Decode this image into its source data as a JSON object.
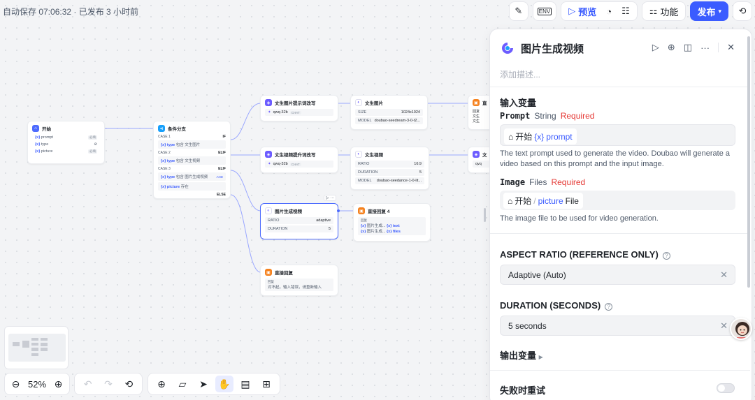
{
  "status": {
    "autosave": "自动保存 07:06:32 · 已发布 3 小时前"
  },
  "topbar": {
    "env_label": "ENV",
    "preview_label": "预览",
    "features_label": "功能",
    "publish_label": "发布"
  },
  "nodes": {
    "start": {
      "title": "开始",
      "rows": [
        {
          "var": "prompt",
          "tag": "必填"
        },
        {
          "var": "type",
          "tag": ""
        },
        {
          "var": "picture",
          "tag": "必填"
        }
      ]
    },
    "cond": {
      "title": "条件分支",
      "case1": "CASE 1",
      "case1_kw": "IF",
      "case1_line": "包含 文生图片",
      "case1_var": "type",
      "case2": "CASE 2",
      "case2_kw": "ELIF",
      "case2_line": "包含 文生视频",
      "case2_var": "type",
      "case3": "CASE 3",
      "case3_kw": "ELIF",
      "case3_line1": "包含 图片生成视频",
      "case3_var1": "type",
      "case3_and": "AND",
      "case3_line2": "存在",
      "case3_var2": "picture",
      "else_kw": "ELSE"
    },
    "t2i_prompt": {
      "title": "文生图片提示词改写",
      "model": "qwq-32b",
      "chip": "CHAT"
    },
    "t2i": {
      "title": "文生图片",
      "size_label": "SIZE",
      "size_val": "1024x1024",
      "model_label": "MODEL",
      "model_val": "doubao-seedream-3-0-t2..."
    },
    "t2v_prompt": {
      "title": "文生视频提升词改写",
      "model": "qwq-32b",
      "chip": "CHAT"
    },
    "t2v": {
      "title": "文生视频",
      "ratio_label": "RATIO",
      "ratio_val": "16:9",
      "dur_label": "DURATION",
      "dur_val": "5",
      "model_label": "MODEL",
      "model_val": "doubao-seedance-1-0-lit..."
    },
    "i2v": {
      "title": "图片生成视频",
      "ratio_label": "RATIO",
      "ratio_val": "adaptive",
      "dur_label": "DURATION",
      "dur_val": "5"
    },
    "reply4": {
      "title": "直接回复 4",
      "sub": "回复",
      "r1": "图片生成...",
      "r1v": "text",
      "r2": "图片生成...",
      "r2v": "files"
    },
    "reply": {
      "title": "直接回复",
      "sub": "回复",
      "text": "对不起，输入错误，请重新输入"
    },
    "right1": {
      "title": "直",
      "sub": "回复",
      "r1": "文生",
      "r2": "文生"
    },
    "right2": {
      "title": "文",
      "model": "qvq"
    }
  },
  "zoom": {
    "value": "52%"
  },
  "panel": {
    "title": "图片生成视频",
    "description_placeholder": "添加描述...",
    "input_section": "输入变量",
    "prompt": {
      "name": "Prompt",
      "type": "String",
      "required": "Required",
      "ref_node": "开始",
      "ref_var": "prompt",
      "help": "The text prompt used to generate the video. Doubao will generate a video based on this prompt and the input image."
    },
    "image": {
      "name": "Image",
      "type": "Files",
      "required": "Required",
      "ref_node": "开始",
      "ref_sep": "/",
      "ref_var": "picture",
      "ref_type": "File",
      "help": "The image file to be used for video generation."
    },
    "aspect": {
      "label": "ASPECT RATIO (REFERENCE ONLY)",
      "value": "Adaptive (Auto)"
    },
    "duration": {
      "label": "DURATION (SECONDS)",
      "value": "5 seconds"
    },
    "output_section": "输出变量",
    "retry_label": "失败时重试"
  }
}
